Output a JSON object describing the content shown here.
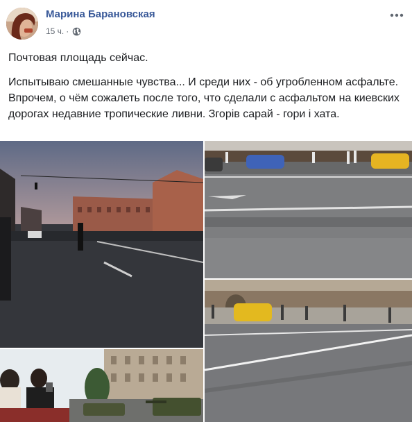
{
  "post": {
    "author": "Марина Барановская",
    "time": "15 ч.",
    "separator": "·",
    "privacy_icon": "globe-icon",
    "menu_icon": "more-icon",
    "paragraphs": [
      "Почтовая площадь сейчас.",
      "Испытываю смешанные чувства... И среди них - об угробленном асфальте. Впрочем, о чём сожалеть после того, что сделали с асфальтом на киевских дорогах недавние тропические ливни. Згорів сарай - гори і хата."
    ]
  },
  "colors": {
    "author": "#385898",
    "meta": "#606770",
    "text": "#1c1e21"
  }
}
